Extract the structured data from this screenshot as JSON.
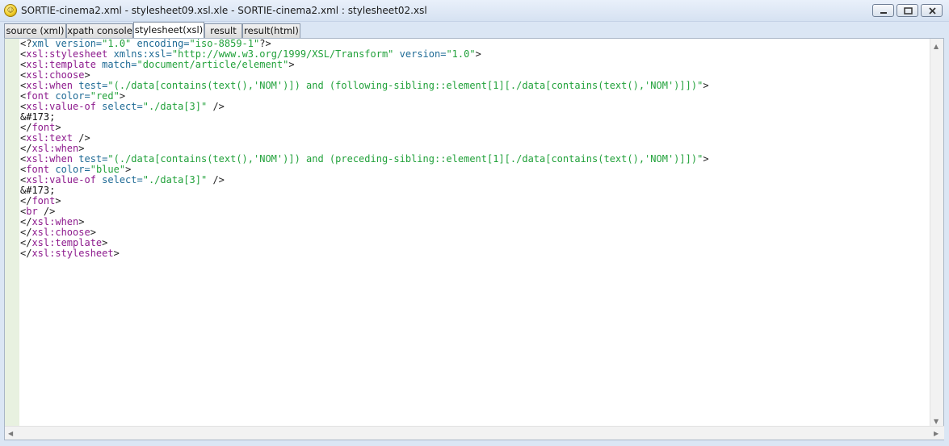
{
  "window": {
    "title": "SORTIE-cinema2.xml - stylesheet09.xsl.xle - SORTIE-cinema2.xml : stylesheet02.xsl",
    "icon": "app-icon"
  },
  "tabs": [
    {
      "label": "source (xml)",
      "active": false
    },
    {
      "label": "xpath console",
      "active": false
    },
    {
      "label": "stylesheet(xsl)",
      "active": true
    },
    {
      "label": "result",
      "active": false
    },
    {
      "label": "result(html)",
      "active": false
    }
  ],
  "colors": {
    "punctuation": "#222222",
    "tag": "#8d1a8d",
    "attribute": "#1e6a95",
    "value": "#21a13a",
    "text": "#111111",
    "gutter": "#e8f1e0"
  },
  "editor": {
    "lines": [
      [
        [
          "p",
          "<?"
        ],
        [
          "a",
          "xml version="
        ],
        [
          "v",
          "\"1.0\""
        ],
        [
          "a",
          " encoding="
        ],
        [
          "v",
          "\"iso-8859-1\""
        ],
        [
          "p",
          "?>"
        ]
      ],
      [
        [
          "p",
          "<"
        ],
        [
          "t",
          "xsl:stylesheet"
        ],
        [
          "a",
          " xmlns:xsl="
        ],
        [
          "v",
          "\"http://www.w3.org/1999/XSL/Transform\""
        ],
        [
          "a",
          " version="
        ],
        [
          "v",
          "\"1.0\""
        ],
        [
          "p",
          ">"
        ]
      ],
      [
        [
          "p",
          "<"
        ],
        [
          "t",
          "xsl:template"
        ],
        [
          "a",
          " match="
        ],
        [
          "v",
          "\"document/article/element\""
        ],
        [
          "p",
          ">"
        ]
      ],
      [
        [
          "p",
          "<"
        ],
        [
          "t",
          "xsl:choose"
        ],
        [
          "p",
          ">"
        ]
      ],
      [
        [
          "p",
          "<"
        ],
        [
          "t",
          "xsl:when"
        ],
        [
          "a",
          " test="
        ],
        [
          "v",
          "\"(./data[contains(text(),'NOM')]) and (following-sibling::element[1][./data[contains(text(),'NOM')]])\""
        ],
        [
          "p",
          ">"
        ]
      ],
      [
        [
          "p",
          "<"
        ],
        [
          "t",
          "font"
        ],
        [
          "a",
          " color="
        ],
        [
          "v",
          "\"red\""
        ],
        [
          "p",
          ">"
        ]
      ],
      [
        [
          "p",
          "<"
        ],
        [
          "t",
          "xsl:value-of"
        ],
        [
          "a",
          " select="
        ],
        [
          "v",
          "\"./data[3]\""
        ],
        [
          "p",
          " />"
        ]
      ],
      [
        [
          "x",
          "&#173;"
        ]
      ],
      [
        [
          "p",
          "</"
        ],
        [
          "t",
          "font"
        ],
        [
          "p",
          ">"
        ]
      ],
      [
        [
          "p",
          "<"
        ],
        [
          "t",
          "xsl:text"
        ],
        [
          "p",
          " />"
        ]
      ],
      [
        [
          "p",
          "</"
        ],
        [
          "t",
          "xsl:when"
        ],
        [
          "p",
          ">"
        ]
      ],
      [
        [
          "p",
          "<"
        ],
        [
          "t",
          "xsl:when"
        ],
        [
          "a",
          " test="
        ],
        [
          "v",
          "\"(./data[contains(text(),'NOM')]) and (preceding-sibling::element[1][./data[contains(text(),'NOM')]])\""
        ],
        [
          "p",
          ">"
        ]
      ],
      [
        [
          "p",
          "<"
        ],
        [
          "t",
          "font"
        ],
        [
          "a",
          " color="
        ],
        [
          "v",
          "\"blue\""
        ],
        [
          "p",
          ">"
        ]
      ],
      [
        [
          "p",
          "<"
        ],
        [
          "t",
          "xsl:value-of"
        ],
        [
          "a",
          " select="
        ],
        [
          "v",
          "\"./data[3]\""
        ],
        [
          "p",
          " />"
        ]
      ],
      [
        [
          "x",
          "&#173;"
        ]
      ],
      [
        [
          "p",
          "</"
        ],
        [
          "t",
          "font"
        ],
        [
          "p",
          ">"
        ]
      ],
      [
        [
          "p",
          "<"
        ],
        [
          "t",
          "br"
        ],
        [
          "p",
          " />"
        ]
      ],
      [
        [
          "p",
          "</"
        ],
        [
          "t",
          "xsl:when"
        ],
        [
          "p",
          ">"
        ]
      ],
      [
        [
          "p",
          "</"
        ],
        [
          "t",
          "xsl:choose"
        ],
        [
          "p",
          ">"
        ]
      ],
      [
        [
          "p",
          "</"
        ],
        [
          "t",
          "xsl:template"
        ],
        [
          "p",
          ">"
        ]
      ],
      [
        [
          "p",
          "</"
        ],
        [
          "t",
          "xsl:stylesheet"
        ],
        [
          "p",
          ">"
        ]
      ]
    ]
  }
}
